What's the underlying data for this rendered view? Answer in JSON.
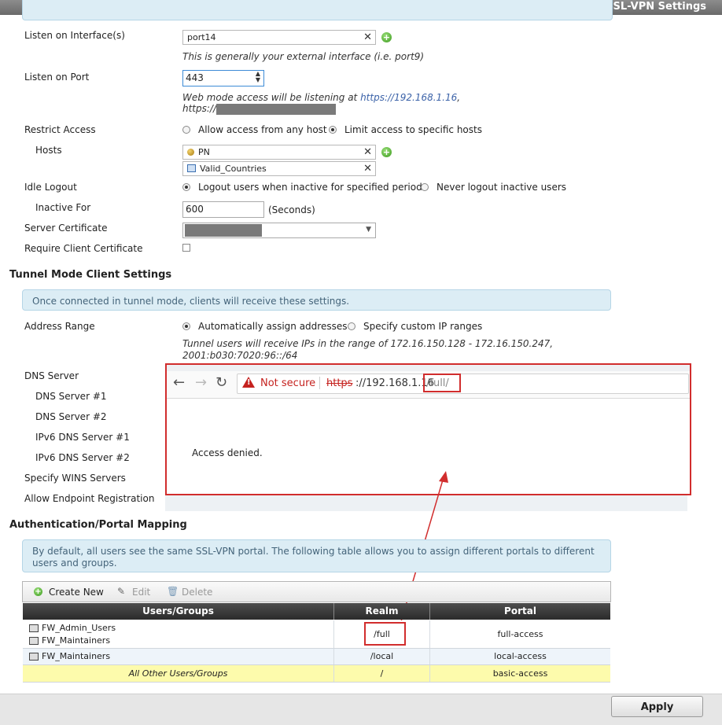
{
  "header": {
    "title": "SSL-VPN Settings"
  },
  "listen_interface": {
    "label": "Listen on Interface(s)",
    "value": "port14",
    "hint": "This is generally your external interface (i.e. port9)"
  },
  "listen_port": {
    "label": "Listen on Port",
    "value": "443",
    "hint_prefix": "Web mode access will be listening at ",
    "hint_url1": "https://192.168.1.16",
    "hint_comma": ",",
    "hint_url2": "https://"
  },
  "restrict_access": {
    "label": "Restrict Access",
    "opt_any": "Allow access from any host",
    "opt_limit": "Limit access to specific hosts",
    "selected": "limit"
  },
  "hosts": {
    "label": "Hosts",
    "items": [
      "PN",
      "Valid_Countries"
    ]
  },
  "idle_logout": {
    "label": "Idle Logout",
    "opt_logout": "Logout users when inactive for specified period",
    "opt_never": "Never logout inactive users"
  },
  "inactive_for": {
    "label": "Inactive For",
    "value": "600",
    "unit": "(Seconds)"
  },
  "server_certificate": {
    "label": "Server Certificate"
  },
  "require_client_cert": {
    "label": "Require Client Certificate",
    "checked": false
  },
  "tunnel": {
    "title": "Tunnel Mode Client Settings",
    "info": "Once connected in tunnel mode, clients will receive these settings.",
    "address_range_label": "Address Range",
    "opt_auto": "Automatically assign addresses",
    "opt_custom": "Specify custom IP ranges",
    "range_hint1": "Tunnel users will receive IPs in the range of 172.16.150.128 - 172.16.150.247,",
    "range_hint2": "2001:b030:7020:96::/64",
    "dns_server": "DNS Server",
    "dns1": "DNS Server #1",
    "dns2": "DNS Server #2",
    "ipv6dns1": "IPv6 DNS Server #1",
    "ipv6dns2": "IPv6 DNS Server #2",
    "wins": "Specify WINS Servers",
    "endpoint": "Allow Endpoint Registration"
  },
  "browser": {
    "not_secure": "Not secure",
    "scheme": "https",
    "url_rest": "://192.168.1.16",
    "path": "/full/",
    "body": "Access denied."
  },
  "auth": {
    "title": "Authentication/Portal Mapping",
    "info": "By default, all users see the same SSL-VPN portal. The following table allows you to assign different portals to different users and groups.",
    "toolbar": {
      "create": "Create New",
      "edit": "Edit",
      "delete": "Delete"
    },
    "columns": [
      "Users/Groups",
      "Realm",
      "Portal"
    ],
    "rows": [
      {
        "users": [
          "FW_Admin_Users",
          "FW_Maintainers"
        ],
        "realm": "/full",
        "portal": "full-access"
      },
      {
        "users": [
          "FW_Maintainers"
        ],
        "realm": "/local",
        "portal": "local-access"
      },
      {
        "users": [
          "All Other Users/Groups"
        ],
        "realm": "/",
        "portal": "basic-access"
      }
    ]
  },
  "apply_label": "Apply",
  "colors": {
    "highlight_red": "#d12d2d",
    "info_bg": "#dcedf5",
    "row_yellow": "#fdfbac"
  }
}
